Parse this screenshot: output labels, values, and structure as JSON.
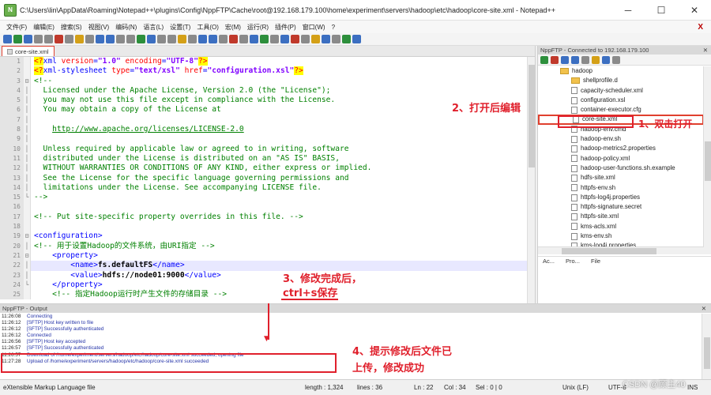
{
  "window": {
    "title": "C:\\Users\\lin\\AppData\\Roaming\\Notepad++\\plugins\\Config\\NppFTP\\Cache\\root@192.168.179.100\\home\\experiment\\servers\\hadoop\\etc\\hadoop\\core-site.xml - Notepad++",
    "minimize": "─",
    "maximize": "☐",
    "close": "✕"
  },
  "menu": [
    "文件(F)",
    "编辑(E)",
    "搜索(S)",
    "视图(V)",
    "编码(N)",
    "语言(L)",
    "设置(T)",
    "工具(O)",
    "宏(M)",
    "运行(R)",
    "插件(P)",
    "窗口(W)",
    "?"
  ],
  "menu_close": "X",
  "toolbar_colors": [
    "#3c6fc1",
    "#2d8f3c",
    "#3c6fc1",
    "#8a8a8a",
    "#8a8a8a",
    "#c0392b",
    "#8a8a8a",
    "#d4a017",
    "#8a8a8a",
    "#3c6fc1",
    "#3c6fc1",
    "#8a8a8a",
    "#8a8a8a",
    "#2d8f3c",
    "#3c6fc1",
    "#8a8a8a",
    "#8a8a8a",
    "#d4a017",
    "#8a8a8a",
    "#3c6fc1",
    "#3c6fc1",
    "#8a8a8a",
    "#c0392b",
    "#8a8a8a",
    "#3c6fc1",
    "#2d8f3c",
    "#8a8a8a",
    "#3c6fc1",
    "#c0392b",
    "#8a8a8a",
    "#d4a017",
    "#3c6fc1",
    "#8a8a8a",
    "#2d8f3c",
    "#3c6fc1"
  ],
  "editor": {
    "tab_label": "core-site.xml",
    "lines": [
      {
        "n": "1",
        "fold": "",
        "parts": [
          {
            "c": "c-pi",
            "t": "<?"
          },
          {
            "c": "c-tag",
            "t": "xml "
          },
          {
            "c": "c-attr",
            "t": "version"
          },
          {
            "c": "c-tag",
            "t": "="
          },
          {
            "c": "c-str",
            "t": "\"1.0\" "
          },
          {
            "c": "c-attr",
            "t": "encoding"
          },
          {
            "c": "c-tag",
            "t": "="
          },
          {
            "c": "c-str",
            "t": "\"UTF-8\""
          },
          {
            "c": "c-pi",
            "t": "?>"
          }
        ]
      },
      {
        "n": "2",
        "fold": "",
        "parts": [
          {
            "c": "c-pi",
            "t": "<?"
          },
          {
            "c": "c-tag",
            "t": "xml-stylesheet "
          },
          {
            "c": "c-attr",
            "t": "type"
          },
          {
            "c": "c-tag",
            "t": "="
          },
          {
            "c": "c-str",
            "t": "\"text/xsl\" "
          },
          {
            "c": "c-attr",
            "t": "href"
          },
          {
            "c": "c-tag",
            "t": "="
          },
          {
            "c": "c-str",
            "t": "\"configuration.xsl\""
          },
          {
            "c": "c-pi",
            "t": "?>"
          }
        ]
      },
      {
        "n": "3",
        "fold": "⊟",
        "parts": [
          {
            "c": "c-com",
            "t": "<!--"
          }
        ]
      },
      {
        "n": "4",
        "fold": "│",
        "parts": [
          {
            "c": "c-com",
            "t": "  Licensed under the Apache License, Version 2.0 (the \"License\");"
          }
        ]
      },
      {
        "n": "5",
        "fold": "│",
        "parts": [
          {
            "c": "c-com",
            "t": "  you may not use this file except in compliance with the License."
          }
        ]
      },
      {
        "n": "6",
        "fold": "│",
        "parts": [
          {
            "c": "c-com",
            "t": "  You may obtain a copy of the License at"
          }
        ]
      },
      {
        "n": "7",
        "fold": "│",
        "parts": [
          {
            "c": "c-com",
            "t": ""
          }
        ]
      },
      {
        "n": "8",
        "fold": "│",
        "parts": [
          {
            "c": "c-com",
            "t": "    "
          },
          {
            "c": "c-link",
            "t": "http://www.apache.org/licenses/LICENSE-2.0"
          }
        ]
      },
      {
        "n": "9",
        "fold": "│",
        "parts": [
          {
            "c": "c-com",
            "t": ""
          }
        ]
      },
      {
        "n": "10",
        "fold": "│",
        "parts": [
          {
            "c": "c-com",
            "t": "  Unless required by applicable law or agreed to in writing, software"
          }
        ]
      },
      {
        "n": "11",
        "fold": "│",
        "parts": [
          {
            "c": "c-com",
            "t": "  distributed under the License is distributed on an \"AS IS\" BASIS,"
          }
        ]
      },
      {
        "n": "12",
        "fold": "│",
        "parts": [
          {
            "c": "c-com",
            "t": "  WITHOUT WARRANTIES OR CONDITIONS OF ANY KIND, either express or implied."
          }
        ]
      },
      {
        "n": "13",
        "fold": "│",
        "parts": [
          {
            "c": "c-com",
            "t": "  See the License for the specific language governing permissions and"
          }
        ]
      },
      {
        "n": "14",
        "fold": "│",
        "parts": [
          {
            "c": "c-com",
            "t": "  limitations under the License. See accompanying LICENSE file."
          }
        ]
      },
      {
        "n": "15",
        "fold": "└",
        "parts": [
          {
            "c": "c-com",
            "t": "-->"
          }
        ]
      },
      {
        "n": "16",
        "fold": "",
        "parts": [
          {
            "c": "c-com",
            "t": ""
          }
        ]
      },
      {
        "n": "17",
        "fold": "",
        "parts": [
          {
            "c": "c-com",
            "t": "<!-- Put site-specific property overrides in this file. -->"
          }
        ]
      },
      {
        "n": "18",
        "fold": "",
        "parts": [
          {
            "c": "c-com",
            "t": ""
          }
        ]
      },
      {
        "n": "19",
        "fold": "⊟",
        "parts": [
          {
            "c": "c-tag",
            "t": "<configuration>"
          }
        ]
      },
      {
        "n": "20",
        "fold": "│",
        "parts": [
          {
            "c": "c-com",
            "t": "<!-- 用于设置Hadoop的文件系统，由URI指定 -->"
          }
        ]
      },
      {
        "n": "21",
        "fold": "⊟",
        "parts": [
          {
            "c": "c-tag",
            "t": "    <property>"
          }
        ]
      },
      {
        "n": "22",
        "fold": "│",
        "hl": true,
        "parts": [
          {
            "c": "c-tag",
            "t": "        <name>"
          },
          {
            "c": "c-text",
            "t": "fs.defaultFS"
          },
          {
            "c": "c-tag",
            "t": "</name>"
          }
        ]
      },
      {
        "n": "23",
        "fold": "│",
        "parts": [
          {
            "c": "c-tag",
            "t": "        <value>"
          },
          {
            "c": "c-text",
            "t": "hdfs://node01:9000"
          },
          {
            "c": "c-tag",
            "t": "</value>"
          }
        ]
      },
      {
        "n": "24",
        "fold": "└",
        "parts": [
          {
            "c": "c-tag",
            "t": "    </property>"
          }
        ]
      },
      {
        "n": "25",
        "fold": "",
        "parts": [
          {
            "c": "c-com",
            "t": "    <!-- 指定Hadoop运行时产生文件的存储目录 -->"
          }
        ]
      }
    ]
  },
  "ftp": {
    "title": "NppFTP - Connected to 192.168.179.100",
    "close": "✕",
    "tool_colors": [
      "#2d8f3c",
      "#c0392b",
      "#3c6fc1",
      "#3c6fc1",
      "#8a8a8a",
      "#d4a017",
      "#3c6fc1",
      "#8a8a8a"
    ],
    "tree": [
      {
        "name": "hadoop",
        "type": "dir",
        "indent": 0
      },
      {
        "name": "shellprofile.d",
        "type": "dir",
        "indent": 1
      },
      {
        "name": "capacity-scheduler.xml",
        "type": "file",
        "indent": 1
      },
      {
        "name": "configuration.xsl",
        "type": "file",
        "indent": 1
      },
      {
        "name": "container-executor.cfg",
        "type": "file",
        "indent": 1
      },
      {
        "name": "core-site.xml",
        "type": "file",
        "indent": 1,
        "selected": true
      },
      {
        "name": "hadoop-env.cmd",
        "type": "file",
        "indent": 1
      },
      {
        "name": "hadoop-env.sh",
        "type": "file",
        "indent": 1
      },
      {
        "name": "hadoop-metrics2.properties",
        "type": "file",
        "indent": 1
      },
      {
        "name": "hadoop-policy.xml",
        "type": "file",
        "indent": 1
      },
      {
        "name": "hadoop-user-functions.sh.example",
        "type": "file",
        "indent": 1
      },
      {
        "name": "hdfs-site.xml",
        "type": "file",
        "indent": 1
      },
      {
        "name": "httpfs-env.sh",
        "type": "file",
        "indent": 1
      },
      {
        "name": "httpfs-log4j.properties",
        "type": "file",
        "indent": 1
      },
      {
        "name": "httpfs-signature.secret",
        "type": "file",
        "indent": 1
      },
      {
        "name": "httpfs-site.xml",
        "type": "file",
        "indent": 1
      },
      {
        "name": "kms-acls.xml",
        "type": "file",
        "indent": 1
      },
      {
        "name": "kms-env.sh",
        "type": "file",
        "indent": 1
      },
      {
        "name": "kms-log4j.properties",
        "type": "file",
        "indent": 1
      }
    ],
    "queue_cols": [
      "Ac...",
      "Pro...",
      "File"
    ]
  },
  "output": {
    "title": "NppFTP - Output",
    "close": "✕",
    "log": [
      {
        "time": "11:26:08",
        "msg": "Connecting"
      },
      {
        "time": "11:26:12",
        "msg": "[SFTP] Host key written to file"
      },
      {
        "time": "11:26:12",
        "msg": "[SFTP] Successfully authenticated"
      },
      {
        "time": "11:26:12",
        "msg": "Connected"
      },
      {
        "time": "11:26:56",
        "msg": "[SFTP] Host key accepted"
      },
      {
        "time": "11:26:57",
        "msg": "[SFTP] Successfully authenticated"
      },
      {
        "time": "11:26:57",
        "msg": "Download of /home/experiment/servers/hadoop/etc/hadoop/core-site.xml succeeded, opening file"
      },
      {
        "time": "11:27:28",
        "msg": "Upload of /home/experiment/servers/hadoop/etc/hadoop/core-site.xml succeeded"
      }
    ]
  },
  "status": {
    "lang": "eXtensible Markup Language file",
    "length": "length : 1,324",
    "lines": "lines : 36",
    "ln": "Ln : 22",
    "col": "Col : 34",
    "sel": "Sel : 0 | 0",
    "eol": "Unix (LF)",
    "enc": "UTF-8",
    "ins": "INS"
  },
  "annotations": {
    "step1": "1、双击打开",
    "step2": "2、打开后编辑",
    "step3_line1": "3、修改完成后，",
    "step3_line2": "ctrl+s保存",
    "step4_line1": "4、提示修改后文件已",
    "step4_line2": "上传，修改成功"
  },
  "watermark": "CSDN @顾主40",
  "colors": {
    "annotation": "#e0202c",
    "accent_tab": "#e0402e"
  }
}
